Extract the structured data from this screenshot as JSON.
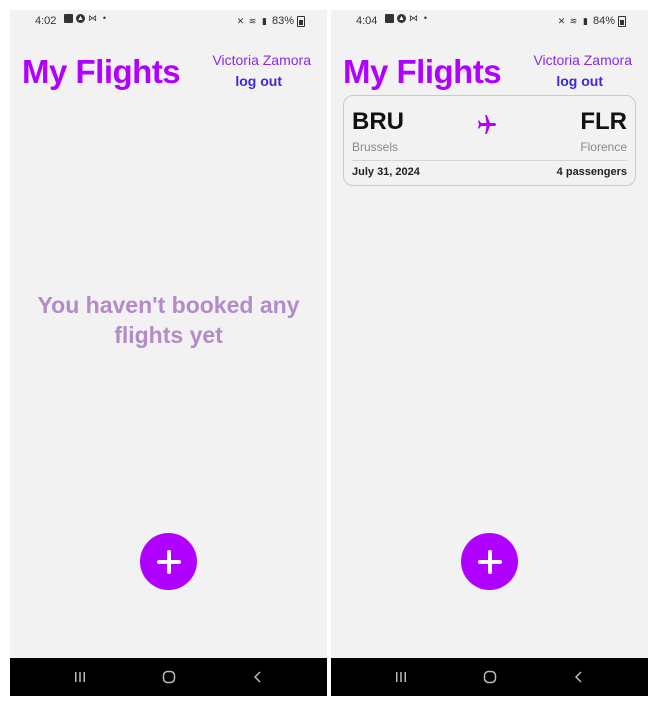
{
  "screens": [
    {
      "status": {
        "time": "4:02",
        "battery": "83%"
      },
      "header": {
        "title": "My Flights",
        "user_name": "Victoria Zamora",
        "logout_label": "log out"
      },
      "empty_message": "You haven't booked any flights yet",
      "fab_icon": "plus-icon"
    },
    {
      "status": {
        "time": "4:04",
        "battery": "84%"
      },
      "header": {
        "title": "My Flights",
        "user_name": "Victoria Zamora",
        "logout_label": "log out"
      },
      "flights": [
        {
          "origin_code": "BRU",
          "origin_city": "Brussels",
          "destination_code": "FLR",
          "destination_city": "Florence",
          "date": "July 31, 2024",
          "passengers": "4 passengers"
        }
      ],
      "fab_icon": "plus-icon"
    }
  ],
  "nav_icons": [
    "recent-apps-icon",
    "home-icon",
    "back-icon"
  ],
  "colors": {
    "accent": "#b000ff",
    "link": "#3a2bd6",
    "user_name": "#8a2be2",
    "empty_text": "#b38bc8",
    "background": "#f2f2f2"
  }
}
